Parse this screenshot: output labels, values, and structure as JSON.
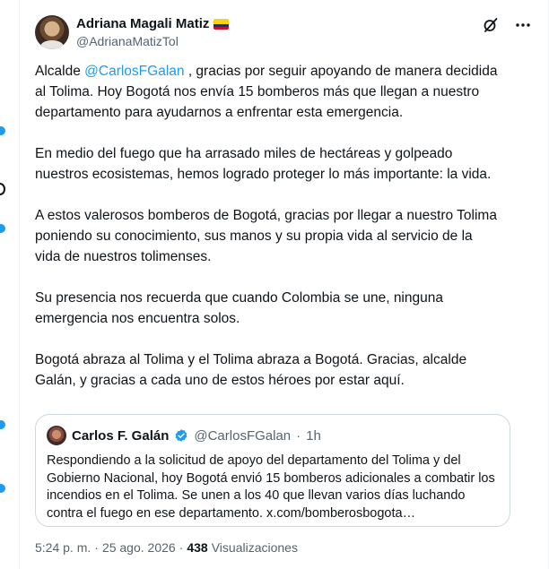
{
  "author": {
    "display_name": "Adriana Magali Matiz",
    "handle": "@AdrianaMatizTol",
    "flag": "colombia-flag"
  },
  "icons": {
    "grok": "grok-icon",
    "more": "more-options-icon"
  },
  "tweet": {
    "p1_prefix": "Alcalde ",
    "p1_mention": "@CarlosFGalan",
    "p1_suffix": " , gracias por seguir apoyando de manera decidida al Tolima. Hoy Bogotá nos envía 15 bomberos más que llegan a nuestro departamento para ayudarnos a enfrentar esta emergencia.",
    "p2": "En medio del fuego que ha arrasado miles de hectáreas y golpeado nuestros ecosistemas, hemos logrado proteger lo más importante: la vida.",
    "p3": "A estos valerosos bomberos de Bogotá, gracias por llegar a nuestro Tolima poniendo su conocimiento, sus manos y su propia vida al servicio de la vida de nuestros tolimenses.",
    "p4": "Su presencia nos recuerda que cuando Colombia se une, ninguna emergencia nos encuentra solos.",
    "p5": "Bogotá abraza al Tolima y el Tolima abraza a Bogotá. Gracias, alcalde Galán, y gracias a cada uno de estos héroes por estar aquí."
  },
  "quote": {
    "display_name": "Carlos F. Galán",
    "handle": "@CarlosFGalan",
    "separator": "·",
    "time": "1h",
    "text": "Respondiendo a la solicitud de apoyo del departamento del Tolima y del Gobierno Nacional, hoy Bogotá envió 15 bomberos adicionales a combatir los incendios en el Tolima. Se unen a los 40 que llevan varios días luchando contra el fuego en ese departamento. x.com/bomberosbogota…"
  },
  "meta": {
    "time": "5:24 p. m.",
    "dot1": "·",
    "date": "25 ago. 2026",
    "dot2": "·",
    "views_count": "438",
    "views_label": "Visualizaciones"
  },
  "colors": {
    "accent": "#1d9bf0",
    "text": "#0f1419",
    "secondary": "#536471",
    "border": "#cfd9de"
  }
}
